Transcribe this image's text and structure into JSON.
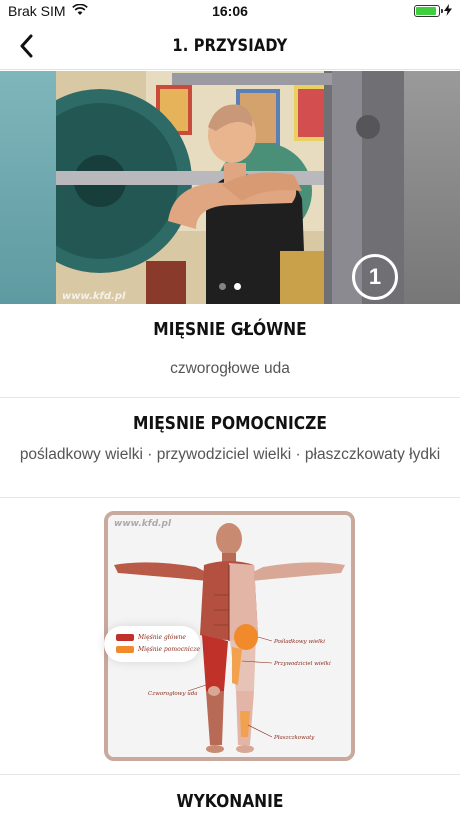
{
  "status_bar": {
    "carrier": "Brak SIM",
    "time": "16:06",
    "battery_level": 0.9,
    "battery_color": "#3ecf3e"
  },
  "nav": {
    "back_icon": "chevron-left-icon",
    "title": "1. PRZYSIADY"
  },
  "carousel": {
    "slide_count": 2,
    "active_slide": 1,
    "step_number": "1",
    "watermark": "www.kfd.pl"
  },
  "main_muscles": {
    "heading": "MIĘSNIE GŁÓWNE",
    "text": "czworogłowe uda"
  },
  "helper_muscles": {
    "heading": "MIĘSNIE POMOCNICZE",
    "text": "pośladkowy wielki · przywodziciel wielki · płaszczkowaty łydki"
  },
  "diagram": {
    "watermark": "www.kfd.pl",
    "legend": [
      {
        "label": "Mięśnie główne",
        "color": "#c0312a"
      },
      {
        "label": "Mięśnie pomocnicze",
        "color": "#f08a2a"
      }
    ],
    "callouts": {
      "gluteus": "Pośladkowy wielki",
      "adductor": "Przywodziciel wielki",
      "quadriceps": "Czworogłowy uda",
      "soleus": "Płaszczkowaty"
    }
  },
  "execution": {
    "heading": "WYKONANIE"
  }
}
